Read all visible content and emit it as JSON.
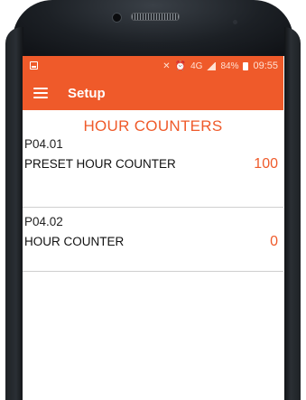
{
  "status_bar": {
    "signal_label": "4G",
    "battery_percent": "84%",
    "time": "09:55",
    "accent_color": "#ef5a2a"
  },
  "toolbar": {
    "menu_icon": "hamburger-menu-icon",
    "title": "Setup"
  },
  "section": {
    "title": "HOUR COUNTERS"
  },
  "parameters": [
    {
      "code": "P04.01",
      "name": "PRESET HOUR COUNTER",
      "value": "100"
    },
    {
      "code": "P04.02",
      "name": "HOUR COUNTER",
      "value": "0"
    }
  ]
}
